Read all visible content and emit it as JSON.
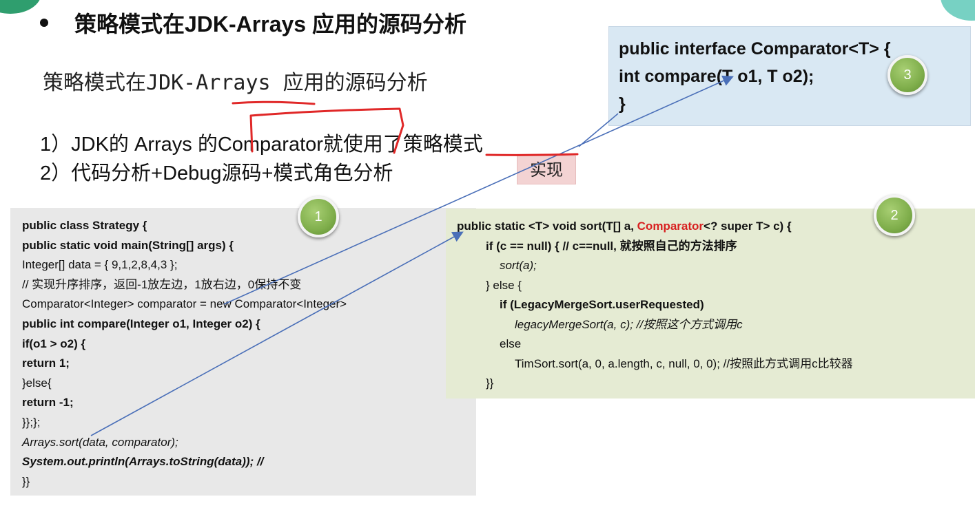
{
  "slide": {
    "title": "策略模式在JDK-Arrays 应用的源码分析",
    "subtitle": "策略模式在JDK-Arrays 应用的源码分析",
    "points": [
      "1）JDK的 Arrays 的Comparator就使用了策略模式",
      "2）代码分析+Debug源码+模式角色分析"
    ],
    "annotation_label": "实现",
    "circle_labels": [
      "1",
      "2",
      "3"
    ]
  },
  "interface_box": {
    "lines": [
      "public interface Comparator<T> {",
      "int compare(T o1, T o2);",
      "}"
    ]
  },
  "client_code": {
    "lines": [
      "public class Strategy {",
      "public static void main(String[] args) {",
      "Integer[] data = { 9,1,2,8,4,3 };",
      "// 实现升序排序，返回-1放左边，1放右边，0保持不变",
      "Comparator<Integer> comparator = new Comparator<Integer>",
      "public int compare(Integer o1, Integer o2) {",
      "if(o1 > o2) {",
      "return 1;",
      "}else{",
      "return -1;",
      "}};};",
      "Arrays.sort(data, comparator);",
      "System.out.println(Arrays.toString(data)); //",
      "}}"
    ]
  },
  "sort_code": {
    "lines": [
      "public static <T> void sort(T[] a, Comparator<? super T> c) {",
      "if (c == null) { // c==null, 就按照自己的方法排序",
      "sort(a);",
      "} else {",
      "if (LegacyMergeSort.userRequested)",
      "legacyMergeSort(a, c); //按照这个方式调用c",
      "else",
      "TimSort.sort(a, 0, a.length, c, null, 0, 0); //按照此方式调用c比较器",
      "}}"
    ],
    "highlight_word": "Comparator"
  },
  "colors": {
    "handwriting_red": "#e02828",
    "arrow_blue": "#4a6fb8",
    "interface_bg": "#d9e8f3",
    "client_bg": "#e8e8e8",
    "sort_bg": "#e5ebd3",
    "badge_bg": "#f3d3d3",
    "circle_green": "#7fae4b"
  }
}
